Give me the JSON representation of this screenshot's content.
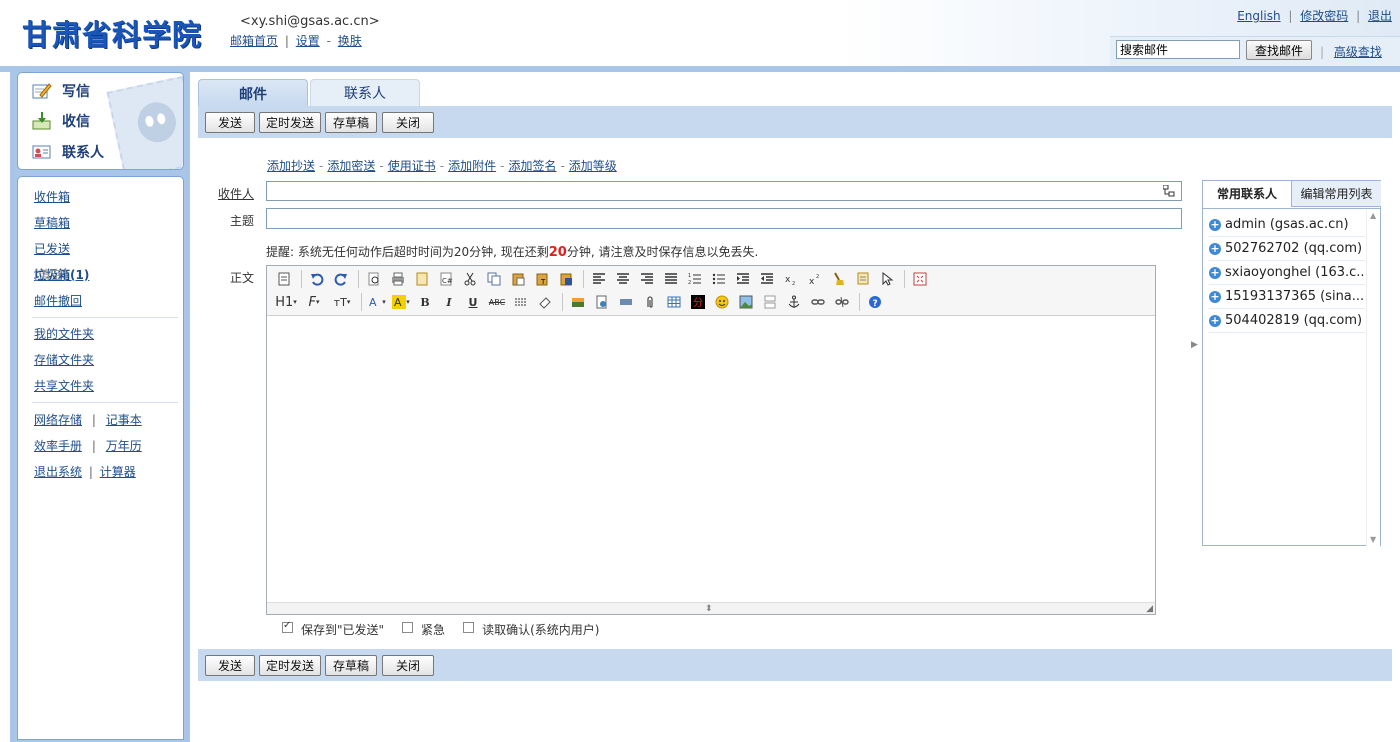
{
  "header": {
    "logo_text": "甘肃省科学院",
    "user_email": "<xy.shi@gsas.ac.cn>",
    "links": {
      "home": "邮箱首页",
      "settings": "设置",
      "skin": "换肤"
    },
    "top_right": {
      "english": "English",
      "change_password": "修改密码",
      "logout": "退出"
    },
    "search": {
      "placeholder": "搜索邮件",
      "button": "查找邮件",
      "advanced": "高级查找"
    }
  },
  "sidebar": {
    "quick": {
      "compose": "写信",
      "receive": "收信",
      "contacts": "联系人"
    },
    "folders": {
      "inbox": "收件箱",
      "drafts": "草稿箱",
      "sent": "已发送",
      "trash": "垃圾箱(1)",
      "clear": "[清空]",
      "recall": "邮件撤回"
    },
    "my_folders": {
      "mine": "我的文件夹",
      "storage": "存储文件夹",
      "shared": "共享文件夹"
    },
    "tools": {
      "net_storage": "网络存储",
      "notebook": "记事本",
      "handbook": "效率手册",
      "calendar": "万年历",
      "exit": "退出系统",
      "calculator": "计算器"
    }
  },
  "tabs": {
    "mail": "邮件",
    "contacts": "联系人"
  },
  "toolbar": {
    "send": "发送",
    "scheduled_send": "定时发送",
    "save_draft": "存草稿",
    "close": "关闭"
  },
  "compose": {
    "add_links": {
      "cc": "添加抄送",
      "bcc": "添加密送",
      "cert": "使用证书",
      "attachment": "添加附件",
      "signature": "添加签名",
      "priority": "添加等级"
    },
    "to_label": "收件人",
    "subject_label": "主题",
    "body_label": "正文",
    "notice_prefix": "提醒: 系统无任何动作后超时时间为20分钟, 现在还剩",
    "notice_minutes": "20",
    "notice_suffix": "分钟, 请注意及时保存信息以免丢失.",
    "options": {
      "save_to_sent": "保存到\"已发送\"",
      "urgent": "紧急",
      "read_receipt": "读取确认(系统内用户)"
    }
  },
  "contact_panel": {
    "tab_common": "常用联系人",
    "tab_edit": "编辑常用列表",
    "contacts": [
      "admin (gsas.ac.cn)",
      "502762702 (qq.com)",
      "sxiaoyonghel (163.c...",
      "15193137365 (sina....",
      "504402819 (qq.com)"
    ]
  },
  "editor": {
    "heading_btn": "H1",
    "font_btn": "F",
    "size_btn": "тT"
  },
  "colors": {
    "accent": "#1a55b8",
    "toolbar": "#c6d9ef",
    "link": "#1f4e8c",
    "warn": "#e02020"
  }
}
